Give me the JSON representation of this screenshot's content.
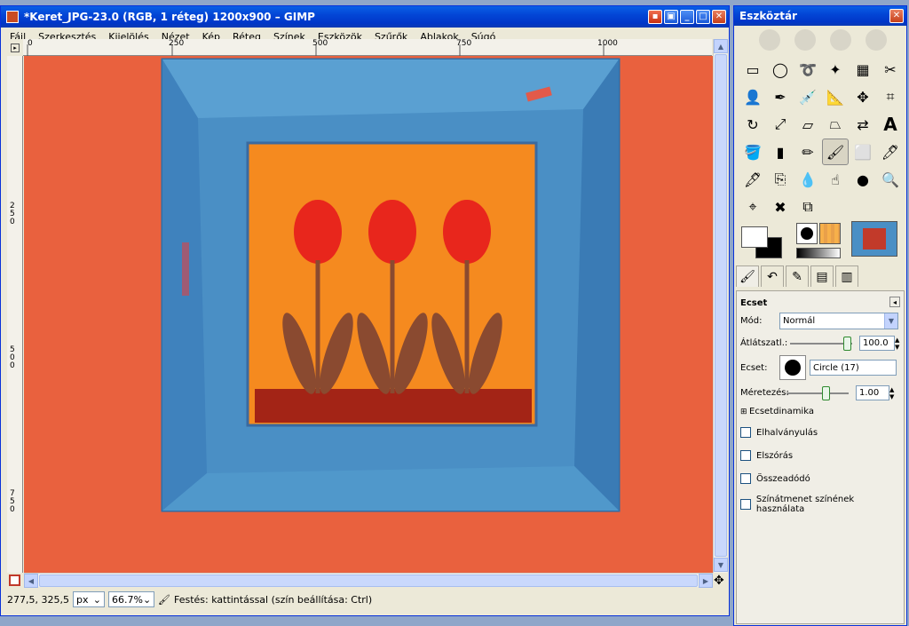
{
  "main_window": {
    "title": "*Keret_JPG-23.0 (RGB, 1 réteg) 1200x900 – GIMP",
    "menu": [
      "Fájl",
      "Szerkesztés",
      "Kijelölés",
      "Nézet",
      "Kép",
      "Réteg",
      "Színek",
      "Eszközök",
      "Szűrők",
      "Ablakok",
      "Súgó"
    ],
    "ruler_h_labels": [
      "0",
      "250",
      "500",
      "750",
      "1000"
    ],
    "ruler_v_labels": [
      "2\n5\n0",
      "5\n0\n0",
      "7\n5\n0"
    ],
    "status": {
      "coords": "277,5, 325,5",
      "unit": "px",
      "zoom": "66.7%",
      "message": "Festés: kattintással (szín beállítása: Ctrl)"
    }
  },
  "toolbox": {
    "title": "Eszköztár",
    "tools": [
      "rect-select",
      "ellipse-select",
      "free-select",
      "fuzzy-select",
      "color-select",
      "scissors",
      "foreground-select",
      "paths",
      "color-picker",
      "zoom",
      "measure",
      "move",
      "align",
      "crop",
      "rotate",
      "scale",
      "shear",
      "perspective",
      "flip",
      "text",
      "bucket-fill",
      "blend",
      "pencil",
      "paintbrush",
      "eraser",
      "airbrush",
      "ink",
      "clone",
      "heal",
      "perspective-clone",
      "blur",
      "smudge",
      "dodge",
      "magnify",
      "cage",
      "fuzzy",
      "warp"
    ],
    "active_tool": "paintbrush",
    "panel": {
      "title": "Ecset",
      "mode_label": "Mód:",
      "mode_value": "Normál",
      "opacity_label": "Átlátszatl.:",
      "opacity_value": "100.0",
      "brush_label": "Ecset:",
      "brush_value": "Circle (17)",
      "size_label": "Méretezés:",
      "size_value": "1.00",
      "dynamics_label": "Ecsetdinamika",
      "checkboxes": [
        "Elhalványulás",
        "Elszórás",
        "Összeadódó",
        "Színátmenet színének használata"
      ]
    }
  },
  "colors": {
    "wall": "#e9613e",
    "frame_blue": "#4a8fc5",
    "inner_orange": "#f58a1f",
    "tulip_red": "#e8261c",
    "leaf": "#8a4a30"
  }
}
